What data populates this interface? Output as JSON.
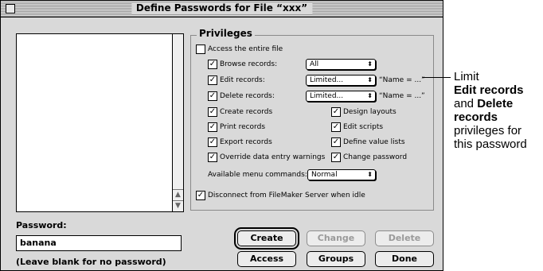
{
  "window": {
    "title": "Define Passwords for File “xxx”"
  },
  "privileges": {
    "group_label": "Privileges",
    "access_entire_file": {
      "label": "Access the entire file",
      "checked": false
    },
    "browse_records": {
      "label": "Browse records:",
      "checked": true,
      "value": "All"
    },
    "edit_records": {
      "label": "Edit records:",
      "checked": true,
      "value": "Limited...",
      "note": "“Name = ...”"
    },
    "delete_records": {
      "label": "Delete records:",
      "checked": true,
      "value": "Limited...",
      "note": "“Name = ...”"
    },
    "create_records": {
      "label": "Create records",
      "checked": true
    },
    "design_layouts": {
      "label": "Design layouts",
      "checked": true
    },
    "print_records": {
      "label": "Print records",
      "checked": true
    },
    "edit_scripts": {
      "label": "Edit scripts",
      "checked": true
    },
    "export_records": {
      "label": "Export records",
      "checked": true
    },
    "define_value_lists": {
      "label": "Define value lists",
      "checked": true
    },
    "override_warnings": {
      "label": "Override data entry warnings",
      "checked": true
    },
    "change_password": {
      "label": "Change password",
      "checked": true
    },
    "menu_commands": {
      "label": "Available menu commands:",
      "value": "Normal"
    },
    "disconnect_idle": {
      "label": "Disconnect from FileMaker Server when idle",
      "checked": true
    }
  },
  "password": {
    "label": "Password:",
    "value": "banana",
    "hint": "(Leave blank for no password)"
  },
  "buttons": {
    "create": "Create",
    "change": "Change",
    "delete": "Delete",
    "access": "Access",
    "groups": "Groups",
    "done": "Done"
  },
  "callout": {
    "line1": "Limit",
    "bold1": "Edit records",
    "and": "and",
    "bold2": "Delete",
    "bold3": "records",
    "line5": "privileges for",
    "line6": "this password"
  },
  "icons": {
    "check": "checkmark-icon",
    "popup": "popup-arrows-icon",
    "scroll_up": "scroll-up-arrow-icon",
    "scroll_down": "scroll-down-arrow-icon"
  }
}
